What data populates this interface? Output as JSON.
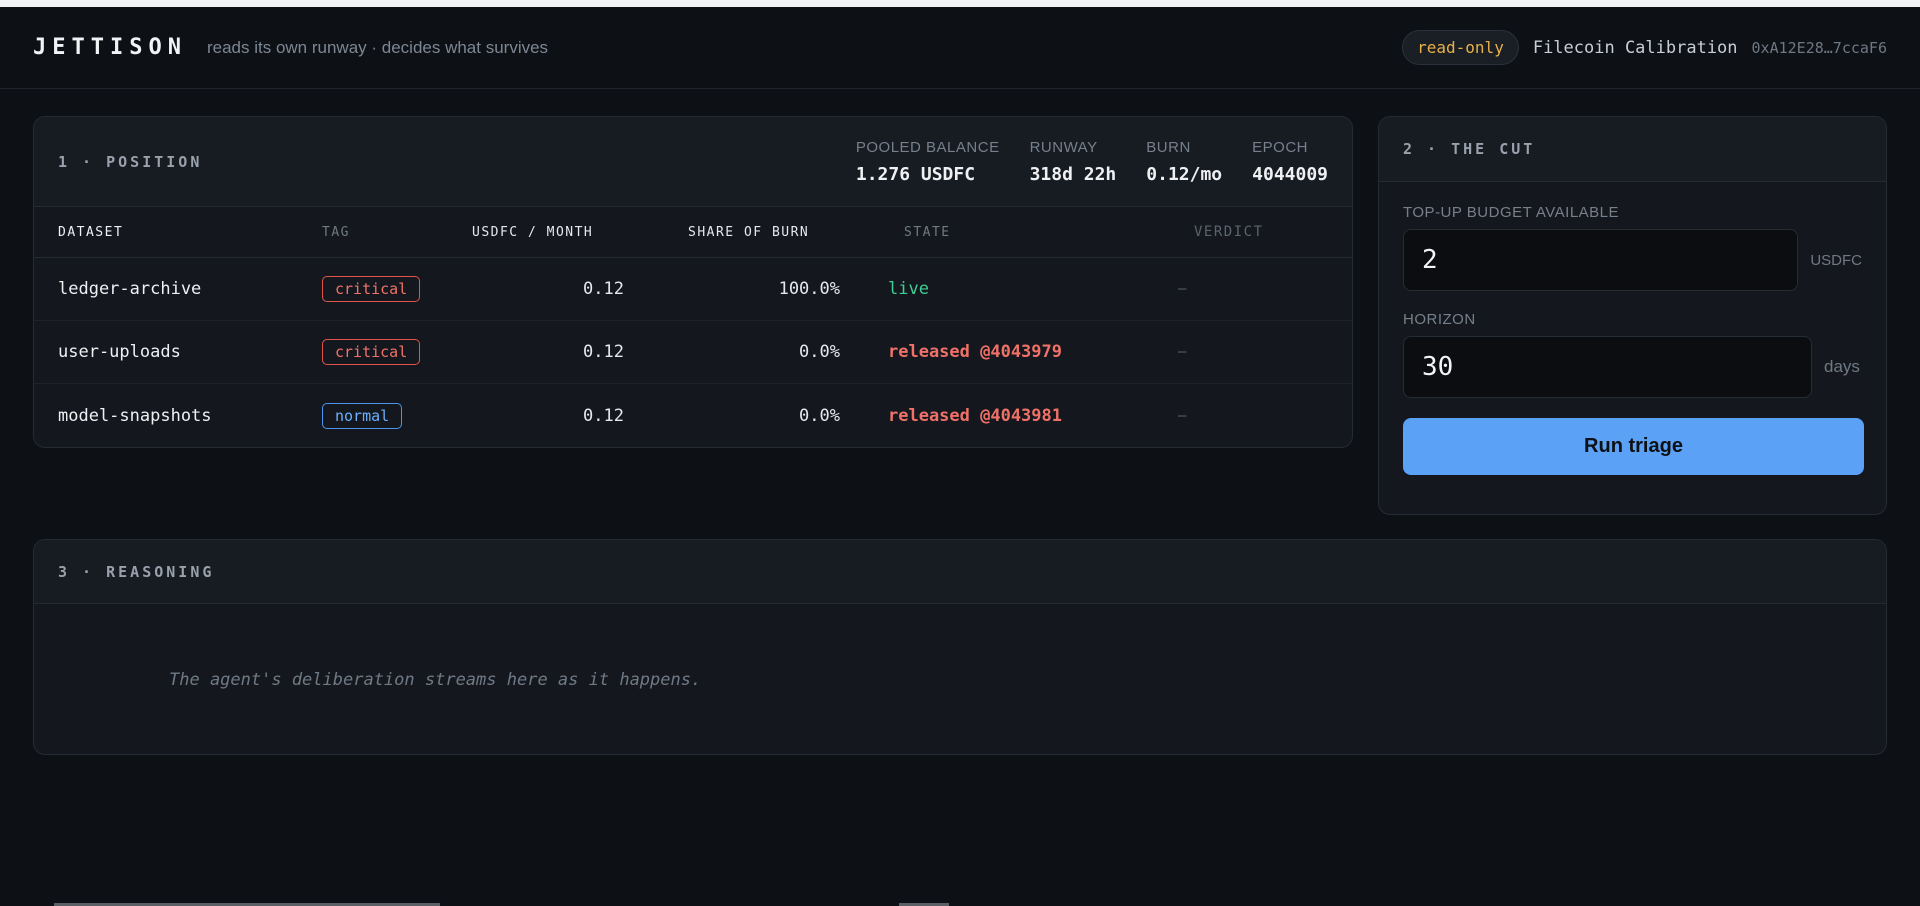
{
  "header": {
    "brand": "JETTISON",
    "tagline": "reads its own runway · decides what survives",
    "mode_badge": "read-only",
    "network": "Filecoin Calibration",
    "address": "0xA12E28…7ccaF6"
  },
  "position": {
    "title": "1 · POSITION",
    "stats": [
      {
        "label": "POOLED BALANCE",
        "value": "1.276 USDFC"
      },
      {
        "label": "RUNWAY",
        "value": "318d 22h"
      },
      {
        "label": "BURN",
        "value": "0.12/mo"
      },
      {
        "label": "EPOCH",
        "value": "4044009"
      }
    ],
    "columns": [
      "DATASET",
      "TAG",
      "USDFC / MONTH",
      "SHARE OF BURN",
      "STATE",
      "VERDICT"
    ],
    "rows": [
      {
        "dataset": "ledger-archive",
        "tag": "critical",
        "usdfc": "0.12",
        "share": "100.0%",
        "state": "live",
        "verdict": "—"
      },
      {
        "dataset": "user-uploads",
        "tag": "critical",
        "usdfc": "0.12",
        "share": "0.0%",
        "state": "released @4043979",
        "verdict": "—"
      },
      {
        "dataset": "model-snapshots",
        "tag": "normal",
        "usdfc": "0.12",
        "share": "0.0%",
        "state": "released @4043981",
        "verdict": "—"
      }
    ]
  },
  "cut": {
    "title": "2 · THE CUT",
    "budget_label": "TOP-UP BUDGET AVAILABLE",
    "budget_value": "2",
    "budget_unit": "USDFC",
    "horizon_label": "HORIZON",
    "horizon_value": "30",
    "horizon_unit": "days",
    "run_label": "Run triage"
  },
  "reasoning": {
    "title": "3 · REASONING",
    "placeholder": "The agent's deliberation streams here as it happens."
  },
  "colors": {
    "accent": "#5ba1f5",
    "critical": "#f07167",
    "normal": "#6ab0ff",
    "live": "#3fce92",
    "warning": "#e8b04a"
  }
}
